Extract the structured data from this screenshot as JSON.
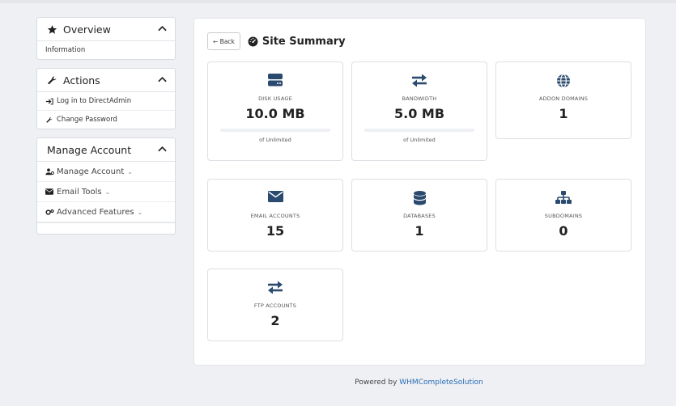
{
  "sidebar": {
    "overview": {
      "title": "Overview",
      "items": [
        "Information"
      ]
    },
    "actions": {
      "title": "Actions",
      "items": [
        "Log in to DirectAdmin",
        "Change Password"
      ]
    },
    "manage": {
      "title": "Manage Account",
      "items": [
        "Manage Account",
        "Email Tools",
        "Advanced Features"
      ]
    }
  },
  "main": {
    "back_label": "← Back",
    "title": "Site Summary",
    "cards": [
      {
        "label": "DISK USAGE",
        "value": "10.0 MB",
        "sub": "of Unlimited",
        "icon": "hdd-icon"
      },
      {
        "label": "BANDWIDTH",
        "value": "5.0 MB",
        "sub": "of Unlimited",
        "icon": "exchange-icon"
      },
      {
        "label": "ADDON DOMAINS",
        "value": "1",
        "icon": "globe-icon"
      },
      {
        "label": "EMAIL ACCOUNTS",
        "value": "15",
        "icon": "envelope-icon"
      },
      {
        "label": "DATABASES",
        "value": "1",
        "icon": "database-icon"
      },
      {
        "label": "SUBDOMAINS",
        "value": "0",
        "icon": "sitemap-icon"
      },
      {
        "label": "FTP ACCOUNTS",
        "value": "2",
        "icon": "exchange-icon"
      }
    ]
  },
  "footer": {
    "prefix": "Powered by ",
    "link": "WHMCompleteSolution"
  },
  "colors": {
    "icon": "#2b4a6f",
    "link": "#2a6bb5",
    "background": "#eef0f3"
  }
}
